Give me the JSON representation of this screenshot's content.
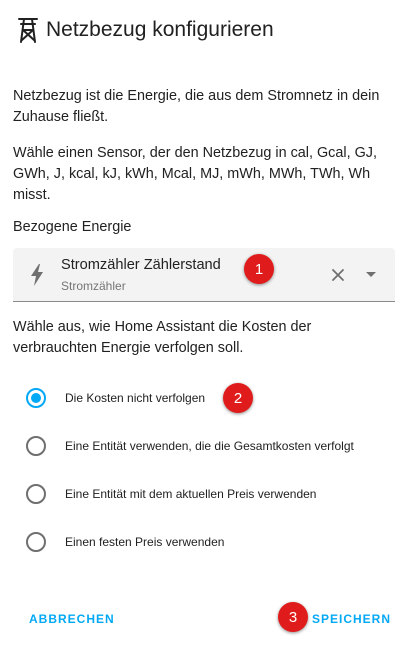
{
  "dialog": {
    "title": "Netzbezug konfigurieren",
    "title_icon": "transmission-tower-icon",
    "description_1": "Netzbezug ist die Energie, die aus dem Stromnetz in dein Zuhause fließt.",
    "description_2": "Wähle einen Sensor, der den Netzbezug in cal, Gcal, GJ, GWh, J, kcal, kJ, kWh, Mcal, MJ, mWh, MWh, TWh, Wh misst."
  },
  "energy_picker": {
    "label": "Bezogene Energie",
    "icon": "flash-icon",
    "entity_name": "Stromzähler Zählerstand",
    "entity_id_label": "Stromzähler",
    "clear_icon": "close-icon",
    "dropdown_icon": "menu-down-icon"
  },
  "cost": {
    "question": "Wähle aus, wie Home Assistant die Kosten der verbrauchten Energie verfolgen soll.",
    "options": [
      {
        "label": "Die Kosten nicht verfolgen",
        "checked": true
      },
      {
        "label": "Eine Entität verwenden, die die Gesamtkosten verfolgt",
        "checked": false
      },
      {
        "label": "Eine Entität mit dem aktuellen Preis verwenden",
        "checked": false
      },
      {
        "label": "Einen festen Preis verwenden",
        "checked": false
      }
    ]
  },
  "actions": {
    "cancel_label": "ABBRECHEN",
    "save_label": "SPEICHERN"
  },
  "annotations": {
    "marker_1": "1",
    "marker_2": "2",
    "marker_3": "3"
  },
  "colors": {
    "accent": "#03a9f4",
    "marker": "#e01b1b"
  }
}
